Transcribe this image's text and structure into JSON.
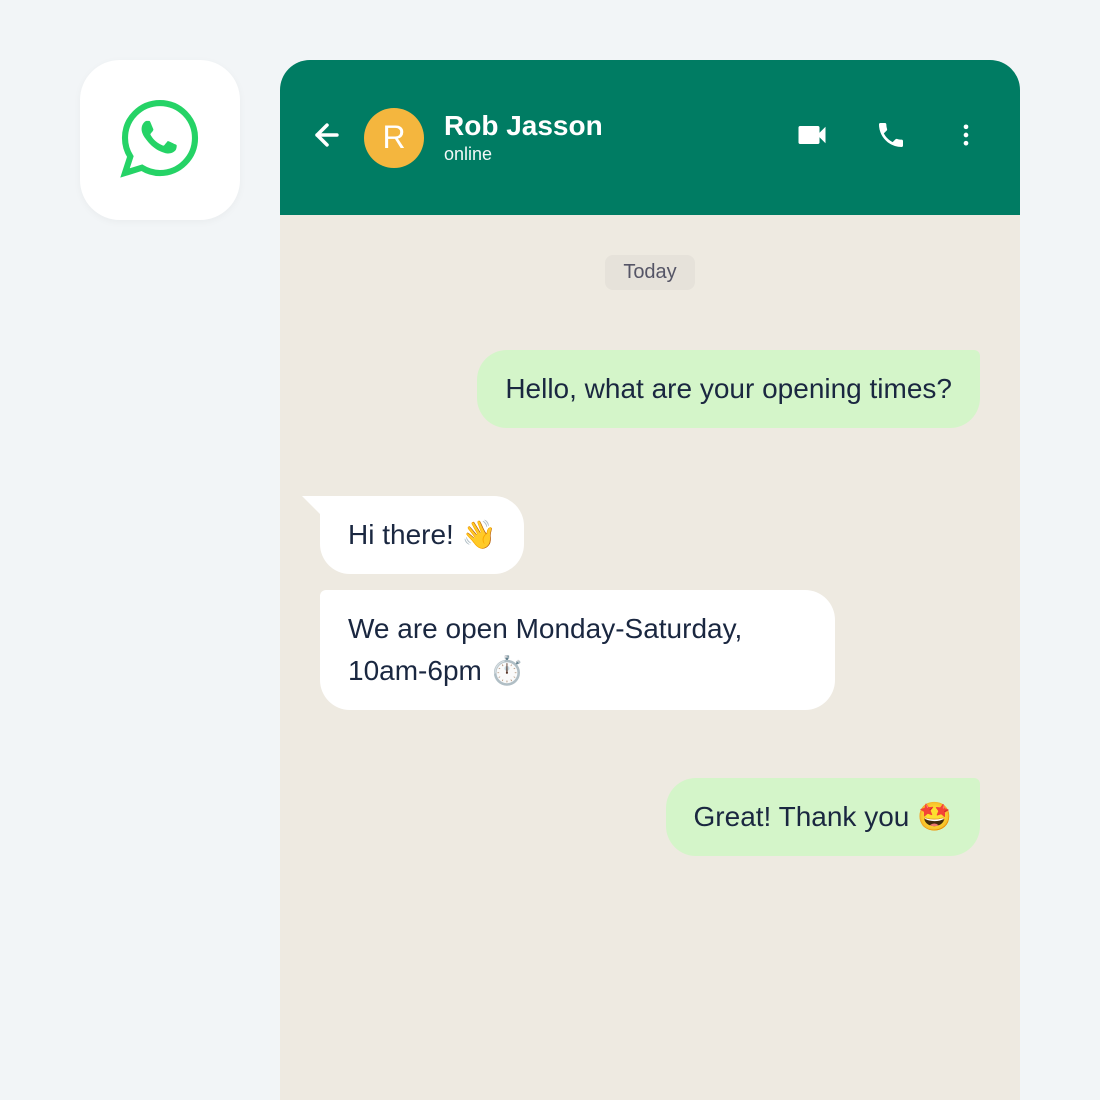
{
  "header": {
    "contact_name": "Rob Jasson",
    "status": "online",
    "avatar_initial": "R"
  },
  "date_label": "Today",
  "messages": [
    {
      "side": "sent",
      "text": "Hello, what are your opening times?"
    },
    {
      "side": "received",
      "text": "Hi there! 👋"
    },
    {
      "side": "received",
      "text": "We are open Monday-Saturday, 10am-6pm ⏱️"
    },
    {
      "side": "sent",
      "text": "Great! Thank you 🤩"
    }
  ],
  "colors": {
    "header_bg": "#007c63",
    "sent_bubble": "#d4f5c9",
    "received_bubble": "#ffffff",
    "chat_bg": "#eeeae1",
    "avatar_bg": "#f4b63e",
    "brand_green": "#25d366"
  },
  "icons": {
    "app_logo": "whatsapp-icon",
    "back": "arrow-left-icon",
    "video": "video-icon",
    "call": "phone-icon",
    "menu": "more-vertical-icon"
  }
}
